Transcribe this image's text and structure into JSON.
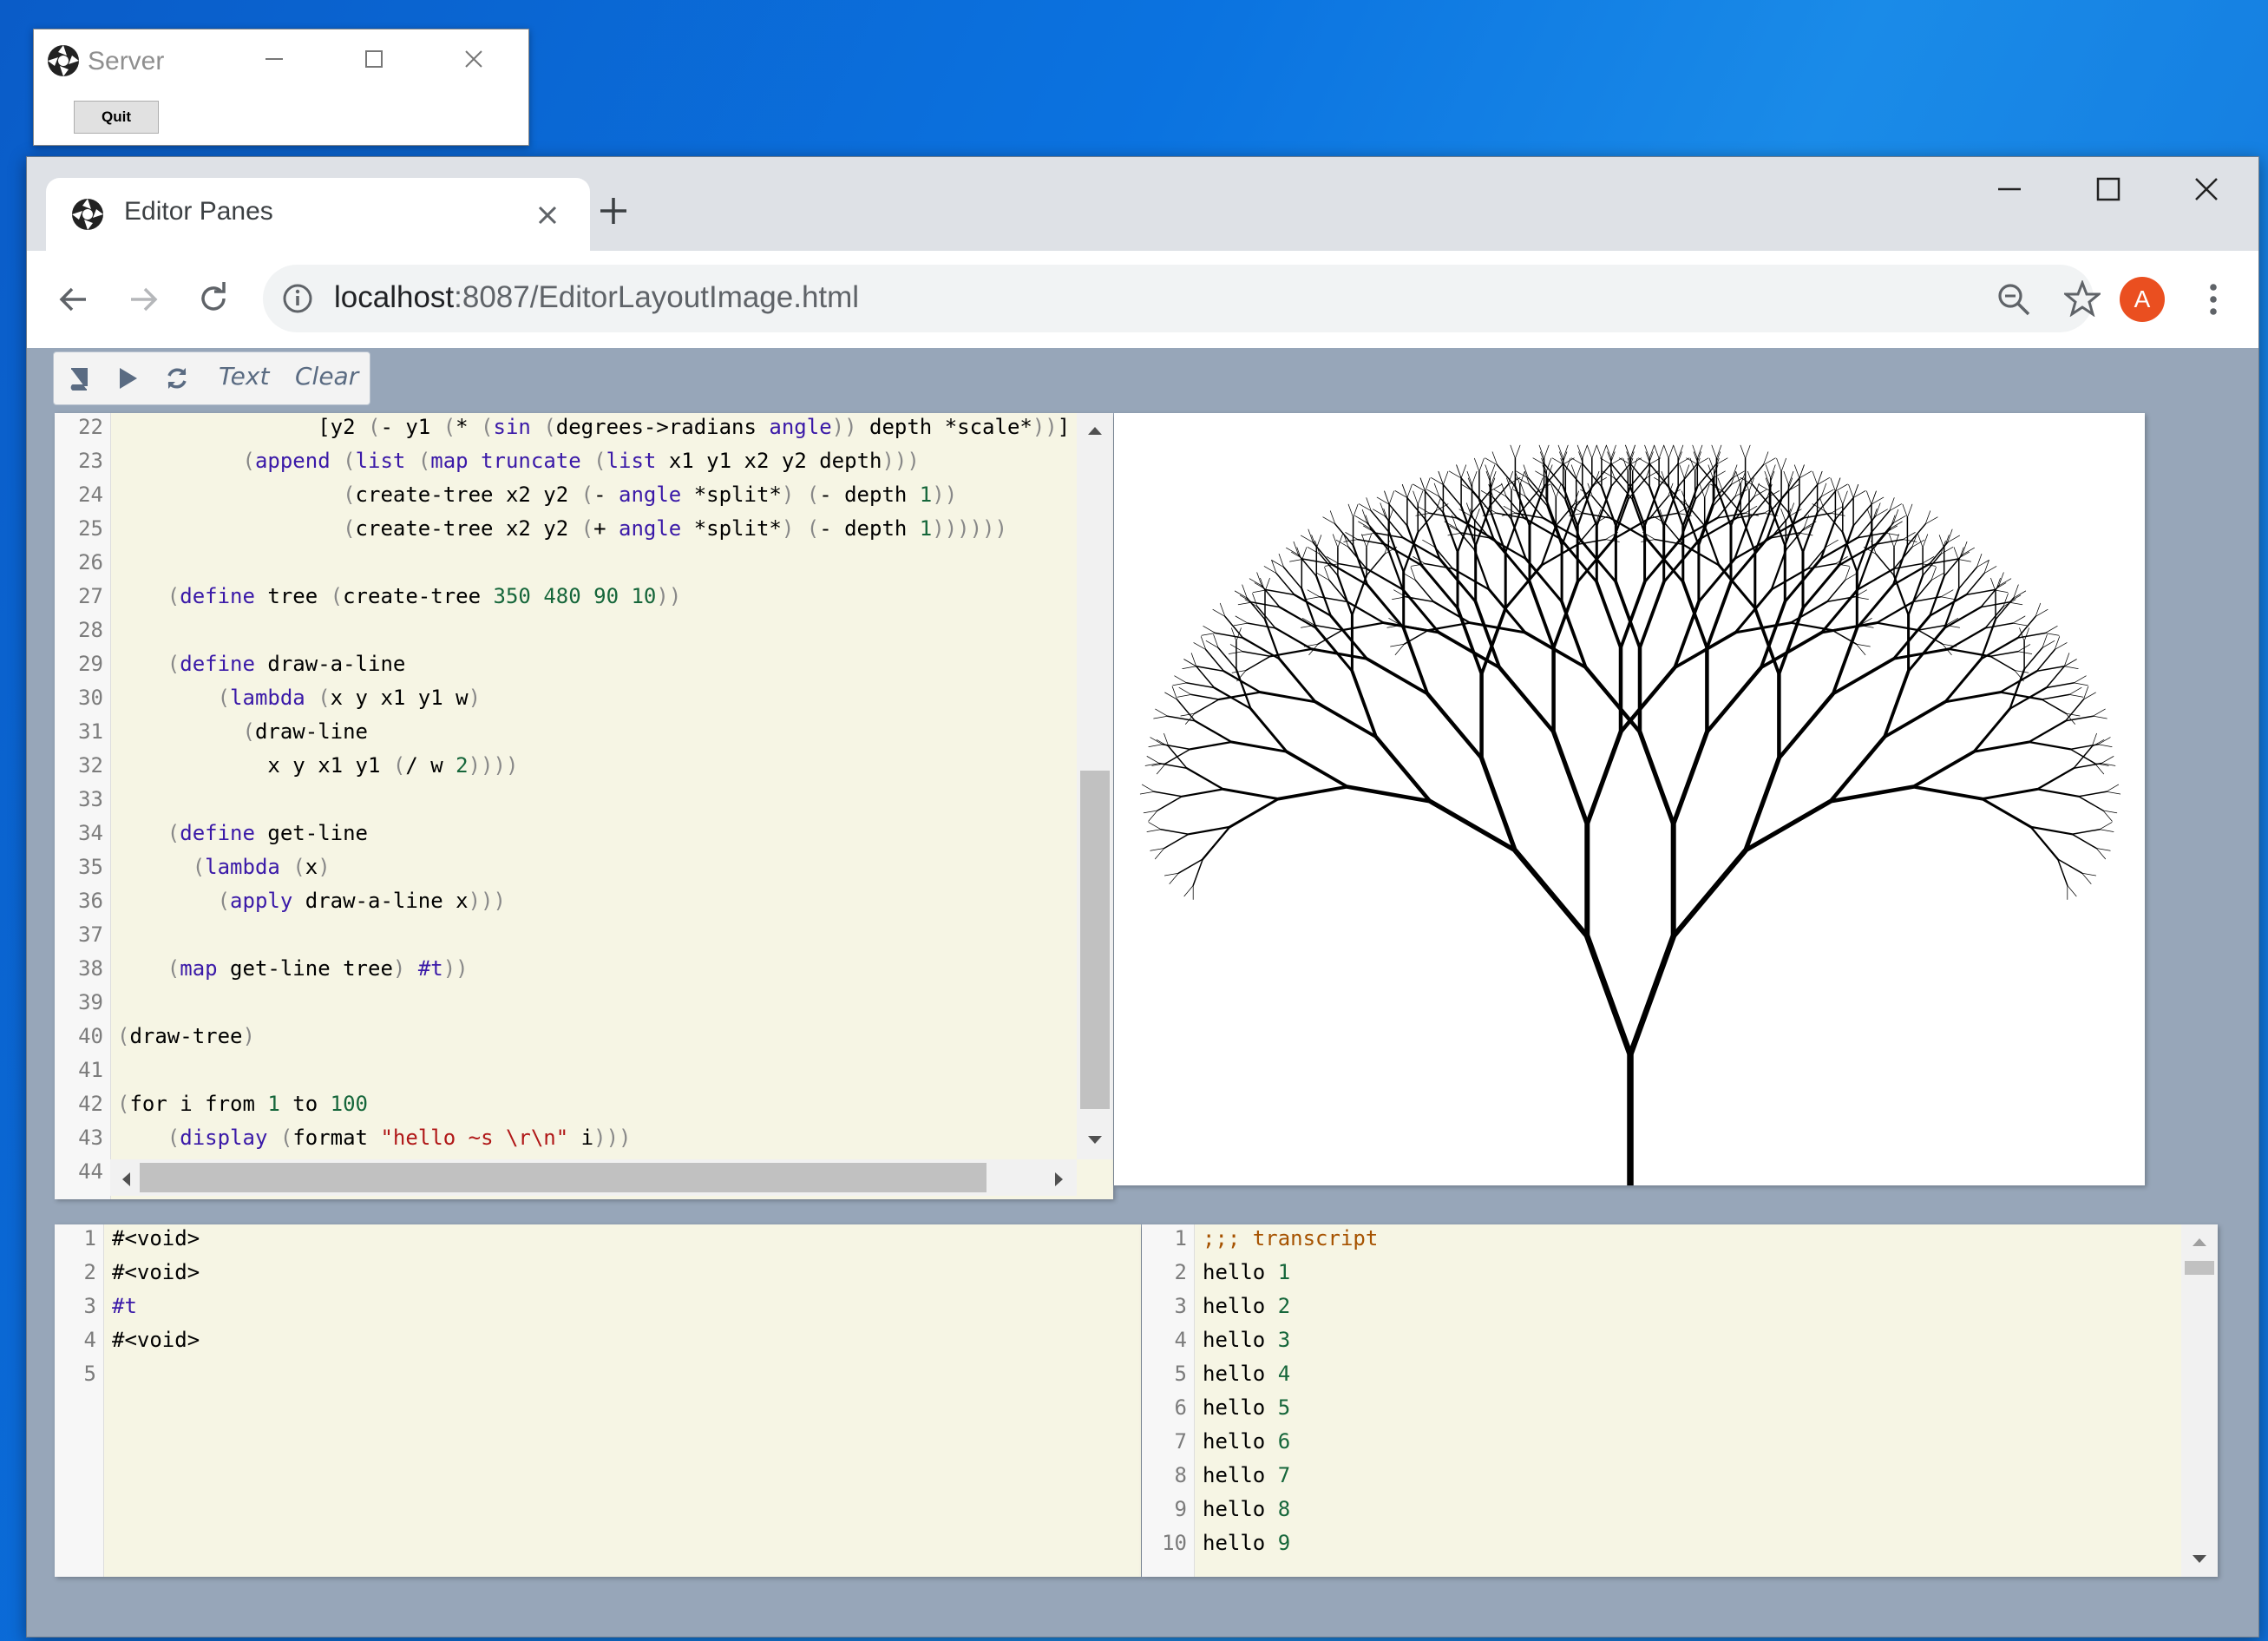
{
  "server_window": {
    "title": "Server",
    "quit_label": "Quit"
  },
  "browser": {
    "tab_title": "Editor Panes",
    "url_host": "localhost",
    "url_rest": ":8087/EditorLayoutImage.html",
    "avatar_letter": "A"
  },
  "editor_toolbar": {
    "text_label": "Text",
    "clear_label": "Clear"
  },
  "main_editor": {
    "line_numbers": [
      "22",
      "23",
      "24",
      "25",
      "26",
      "27",
      "28",
      "29",
      "30",
      "31",
      "32",
      "33",
      "34",
      "35",
      "36",
      "37",
      "38",
      "39",
      "40",
      "41",
      "42",
      "43",
      "44"
    ]
  },
  "result_pane": {
    "line_numbers": [
      "1",
      "2",
      "3",
      "4",
      "5"
    ],
    "lines": [
      "#<void>",
      "#<void>",
      "#t",
      "#<void>",
      ""
    ]
  },
  "transcript_pane": {
    "line_numbers": [
      "1",
      "2",
      "3",
      "4",
      "5",
      "6",
      "7",
      "8",
      "9",
      "10"
    ],
    "header": ";;; transcript",
    "word": "hello",
    "values": [
      "1",
      "2",
      "3",
      "4",
      "5",
      "6",
      "7",
      "8",
      "9"
    ]
  },
  "canvas": {
    "description_icon": "fractal-tree-drawing"
  }
}
